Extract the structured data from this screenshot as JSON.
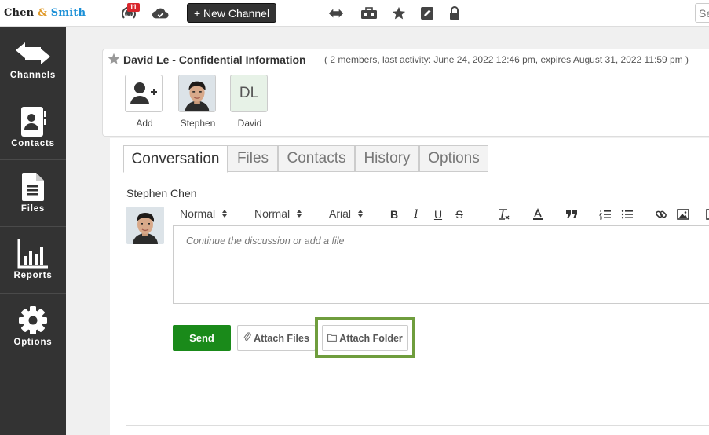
{
  "topbar": {
    "logo": {
      "part1": "Chen",
      "amp": "&",
      "part2": "Smith"
    },
    "notification_count": "11",
    "new_channel_label": "+ New Channel",
    "search_placeholder": "Search"
  },
  "sidebar": {
    "items": [
      {
        "label": "Channels"
      },
      {
        "label": "Contacts"
      },
      {
        "label": "Files"
      },
      {
        "label": "Reports"
      },
      {
        "label": "Options"
      }
    ]
  },
  "channel": {
    "title": "David Le - Confidential Information",
    "meta": "( 2 members, last activity: June 24, 2022 12:46 pm, expires August 31, 2022 11:59 pm )",
    "members": [
      {
        "label": "Add"
      },
      {
        "label": "Stephen"
      },
      {
        "label": "David",
        "initials": "DL"
      }
    ]
  },
  "tabs": [
    {
      "label": "Conversation"
    },
    {
      "label": "Files"
    },
    {
      "label": "Contacts"
    },
    {
      "label": "History"
    },
    {
      "label": "Options"
    }
  ],
  "composer": {
    "author": "Stephen Chen",
    "toolbar": {
      "heading": "Normal",
      "size": "Normal",
      "font": "Arial"
    },
    "placeholder": "Continue the discussion or add a file",
    "send_label": "Send",
    "attach_files_label": "Attach Files",
    "attach_folder_label": "Attach Folder"
  },
  "colors": {
    "sidebar": "#333333",
    "send": "#1a8a1a",
    "highlight": "#6f9d3d",
    "badge": "#d9262c",
    "brand_blue": "#1a8fd6"
  }
}
